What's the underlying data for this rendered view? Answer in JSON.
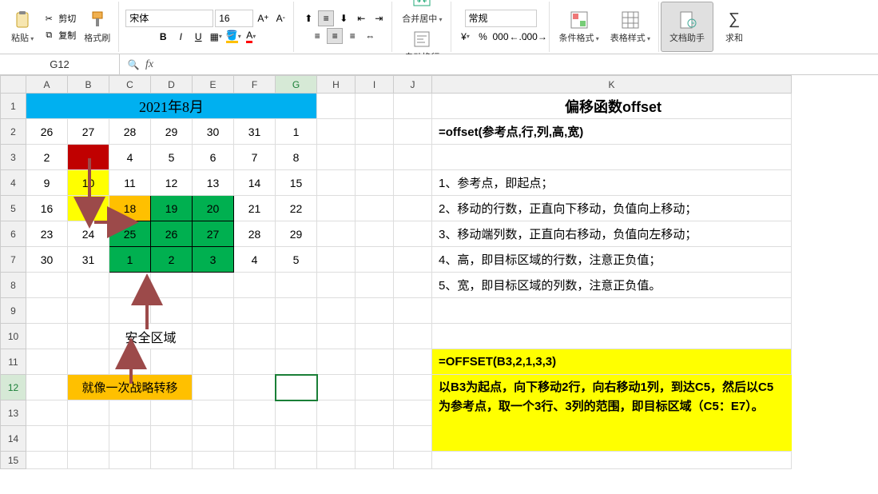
{
  "ribbon": {
    "paste": "粘贴",
    "cut": "剪切",
    "copy": "复制",
    "format_painter": "格式刷",
    "font_name": "宋体",
    "font_size": "16",
    "bold": "B",
    "italic": "I",
    "underline": "U",
    "merge": "合并居中",
    "wrap": "自动换行",
    "number_format": "常规",
    "cond_fmt": "条件格式",
    "table_fmt": "表格样式",
    "doc_helper": "文档助手",
    "sum": "求和"
  },
  "namebox": "G12",
  "fx_label": "fx",
  "cols": [
    "A",
    "B",
    "C",
    "D",
    "E",
    "F",
    "G",
    "H",
    "I",
    "J",
    "K"
  ],
  "title": "2021年8月",
  "cal": [
    [
      "26",
      "27",
      "28",
      "29",
      "30",
      "31",
      "1"
    ],
    [
      "2",
      "3",
      "4",
      "5",
      "6",
      "7",
      "8"
    ],
    [
      "9",
      "10",
      "11",
      "12",
      "13",
      "14",
      "15"
    ],
    [
      "16",
      "17",
      "18",
      "19",
      "20",
      "21",
      "22"
    ],
    [
      "23",
      "24",
      "25",
      "26",
      "27",
      "28",
      "29"
    ],
    [
      "30",
      "31",
      "1",
      "2",
      "3",
      "4",
      "5"
    ]
  ],
  "safe_area": "安全区域",
  "strategy": "就像一次战略转移",
  "right": {
    "title": "偏移函数offset",
    "sig": "=offset(参考点,行,列,高,宽)",
    "p1": "1、参考点，即起点；",
    "p2": "2、移动的行数，正直向下移动，负值向上移动；",
    "p3": "3、移动端列数，正直向右移动，负值向左移动；",
    "p4": "4、高，即目标区域的行数，注意正负值；",
    "p5": "5、宽，即目标区域的列数，注意正负值。",
    "formula": "=OFFSET(B3,2,1,3,3)",
    "desc": "以B3为起点，向下移动2行，向右移动1列，到达C5，然后以C5为参考点，取一个3行、3列的范围，即目标区域（C5：E7）。"
  }
}
